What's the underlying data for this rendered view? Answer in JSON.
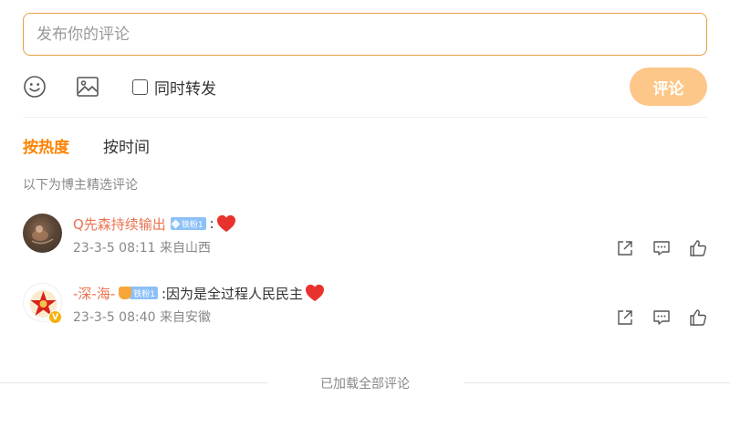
{
  "composer": {
    "placeholder": "发布你的评论",
    "repost_label": "同时转发",
    "submit_label": "评论",
    "tools": [
      "emoji-icon",
      "image-icon"
    ]
  },
  "sort": {
    "tabs": [
      {
        "label": "按热度",
        "active": true
      },
      {
        "label": "按时间",
        "active": false
      }
    ]
  },
  "selected_note": "以下为博主精选评论",
  "comments": [
    {
      "username": "Q先森持续输出",
      "badge": "铁粉1",
      "text": ":",
      "emoji": "heart-icon",
      "meta": "23-3-5 08:11 来自山西",
      "verified": false
    },
    {
      "username": "-深-海-",
      "badge": "铁粉1",
      "text": ":因为是全过程人民民主",
      "emoji": "heart-icon",
      "meta": "23-3-5 08:40 来自安徽",
      "verified": true
    }
  ],
  "footer_text": "已加载全部评论",
  "colors": {
    "accent": "#ff8200",
    "username": "#eb7350",
    "submit_bg": "#fcc788",
    "input_border": "#e3a042",
    "fan_badge": "#8cc0f7",
    "heart": "#e8322e"
  }
}
